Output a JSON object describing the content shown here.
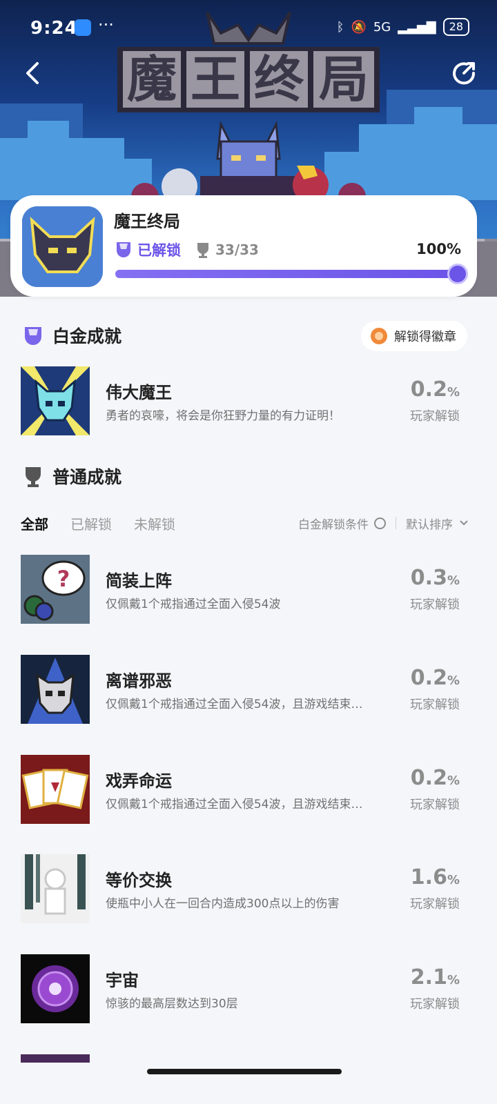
{
  "status_bar": {
    "time": "9:24",
    "dots": "···",
    "network": "5G",
    "battery": "28"
  },
  "game": {
    "title": "魔王终局",
    "unlock_status": "已解锁",
    "trophy_count": "33/33",
    "progress_percent": "100%",
    "progress_value": 1.0
  },
  "platinum": {
    "section_title": "白金成就",
    "badge_button": "解锁得徽章",
    "item": {
      "name": "伟大魔王",
      "desc": "勇者的哀嚎，将会是你狂野力量的有力证明！",
      "rate": "0.2",
      "rate_label": "玩家解锁"
    }
  },
  "normal": {
    "section_title": "普通成就",
    "tabs": [
      "全部",
      "已解锁",
      "未解锁"
    ],
    "condition_label": "白金解锁条件",
    "sort_label": "默认排序",
    "items": [
      {
        "name": "简装上阵",
        "desc": "仅佩戴1个戒指通过全面入侵54波",
        "rate": "0.3",
        "rate_label": "玩家解锁"
      },
      {
        "name": "离谱邪恶",
        "desc": "仅佩戴1个戒指通过全面入侵54波，且游戏结束…",
        "rate": "0.2",
        "rate_label": "玩家解锁"
      },
      {
        "name": "戏弄命运",
        "desc": "仅佩戴1个戒指通过全面入侵54波，且游戏结束…",
        "rate": "0.2",
        "rate_label": "玩家解锁"
      },
      {
        "name": "等价交换",
        "desc": "使瓶中小人在一回合内造成300点以上的伤害",
        "rate": "1.6",
        "rate_label": "玩家解锁"
      },
      {
        "name": "宇宙",
        "desc": "惊骇的最高层数达到30层",
        "rate": "2.1",
        "rate_label": "玩家解锁"
      }
    ]
  },
  "percent_sign": "%",
  "colors": {
    "accent": "#6b54e8",
    "background": "#f4f6f9",
    "rate_gray": "#8c8c8c"
  }
}
